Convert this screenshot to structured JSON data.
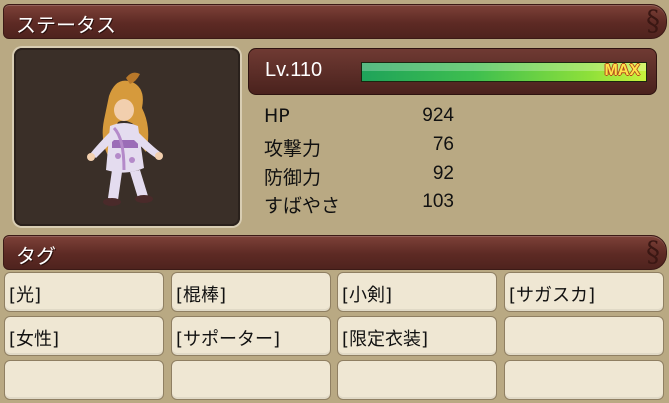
{
  "status_panel": {
    "title": "ステータス"
  },
  "level": {
    "label": "Lv.110",
    "xp_fill_fraction": 1.0,
    "max_label": "MAX"
  },
  "stats": [
    {
      "name": "HP",
      "value": "924"
    },
    {
      "name": "攻撃力",
      "value": "76"
    },
    {
      "name": "防御力",
      "value": "92"
    },
    {
      "name": "すばやさ",
      "value": "103"
    }
  ],
  "tags_panel": {
    "title": "タグ"
  },
  "tags": [
    "[光]",
    "[棍棒]",
    "[小剣]",
    "[サガスカ]",
    "[女性]",
    "[サポーター]",
    "[限定衣装]",
    "",
    "",
    "",
    "",
    ""
  ],
  "colors": {
    "bar": "#5d2a24",
    "cell": "#efe7d3",
    "xp_start": "#1fa35a",
    "xp_end": "#c9f23c",
    "max": "#ffe24a"
  },
  "icons": {
    "corner_ornament": "swirl-icon"
  }
}
